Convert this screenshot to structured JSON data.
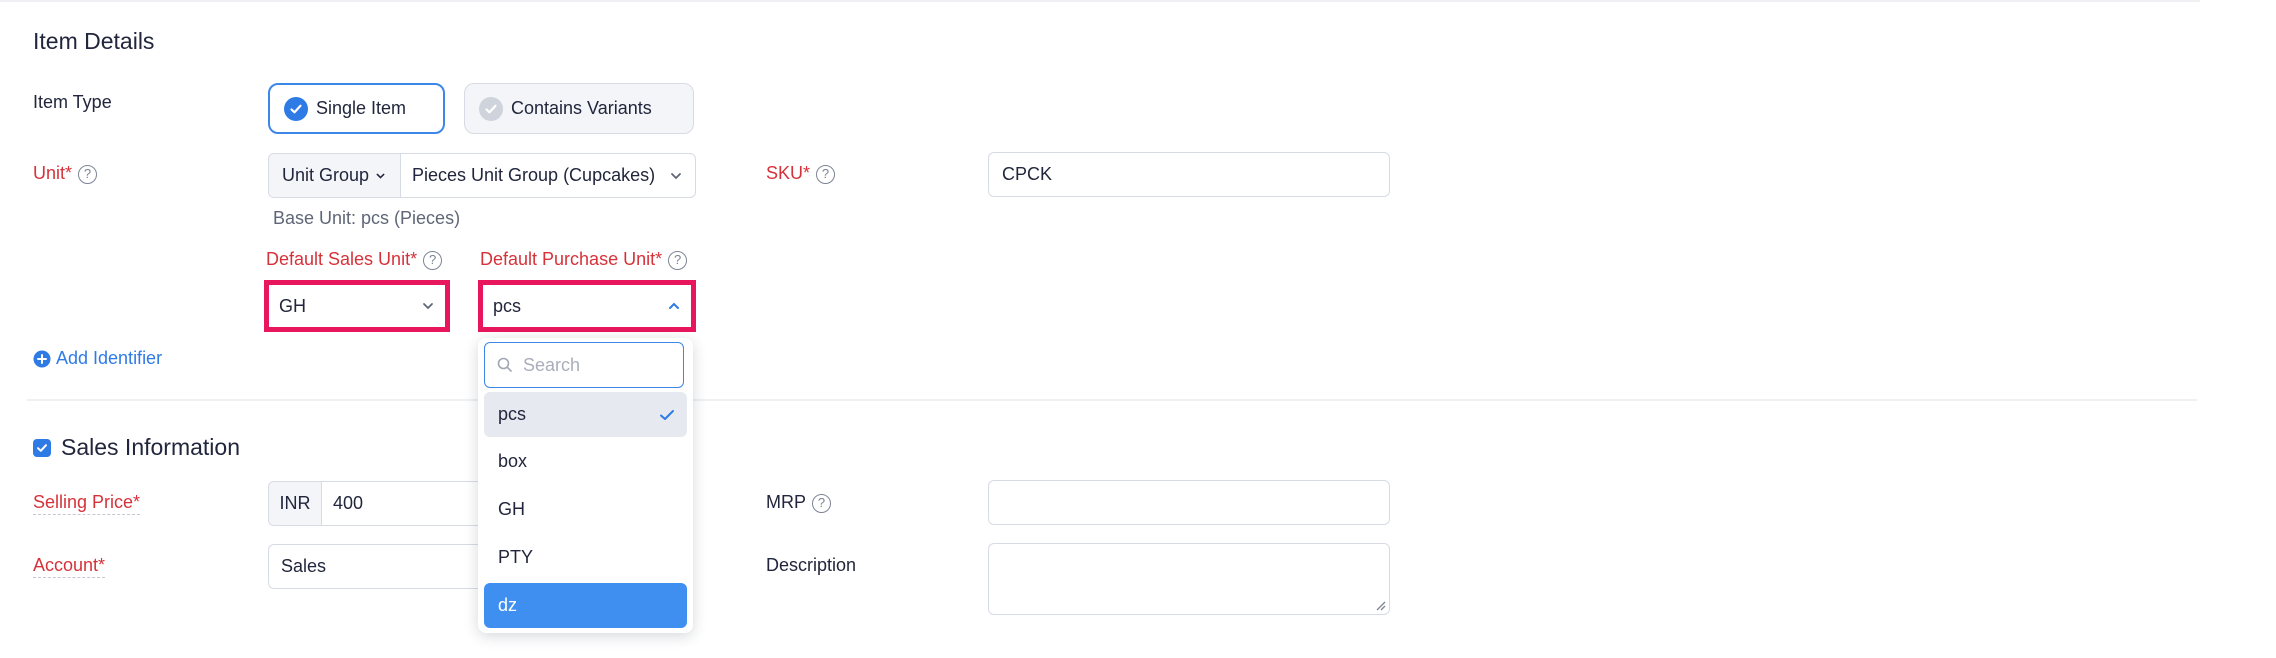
{
  "item_details": {
    "title": "Item Details",
    "item_type_label": "Item Type",
    "item_type_options": [
      "Single Item",
      "Contains Variants"
    ],
    "unit_label": "Unit*",
    "unit_group_button": "Unit Group",
    "unit_group_value": "Pieces Unit Group (Cupcakes)",
    "base_unit_text": "Base Unit: pcs (Pieces)",
    "default_sales_unit_label": "Default Sales Unit*",
    "default_sales_unit_value": "GH",
    "default_purchase_unit_label": "Default Purchase Unit*",
    "default_purchase_unit_value": "pcs",
    "sku_label": "SKU*",
    "sku_value": "CPCK",
    "add_identifier": "Add Identifier"
  },
  "dropdown": {
    "search_placeholder": "Search",
    "options": [
      "pcs",
      "box",
      "GH",
      "PTY",
      "dz"
    ],
    "selected": "pcs",
    "highlighted": "dz"
  },
  "sales_info": {
    "title": "Sales Information",
    "selling_price_label": "Selling Price*",
    "currency": "INR",
    "selling_price_value": "400",
    "mrp_label": "MRP",
    "mrp_value": "",
    "account_label": "Account*",
    "account_value": "Sales",
    "description_label": "Description",
    "description_value": ""
  },
  "colors": {
    "accent": "#2f7be6",
    "required": "#d6323a",
    "highlight_border": "#e8175d",
    "hover_option": "#3f8ff0"
  }
}
